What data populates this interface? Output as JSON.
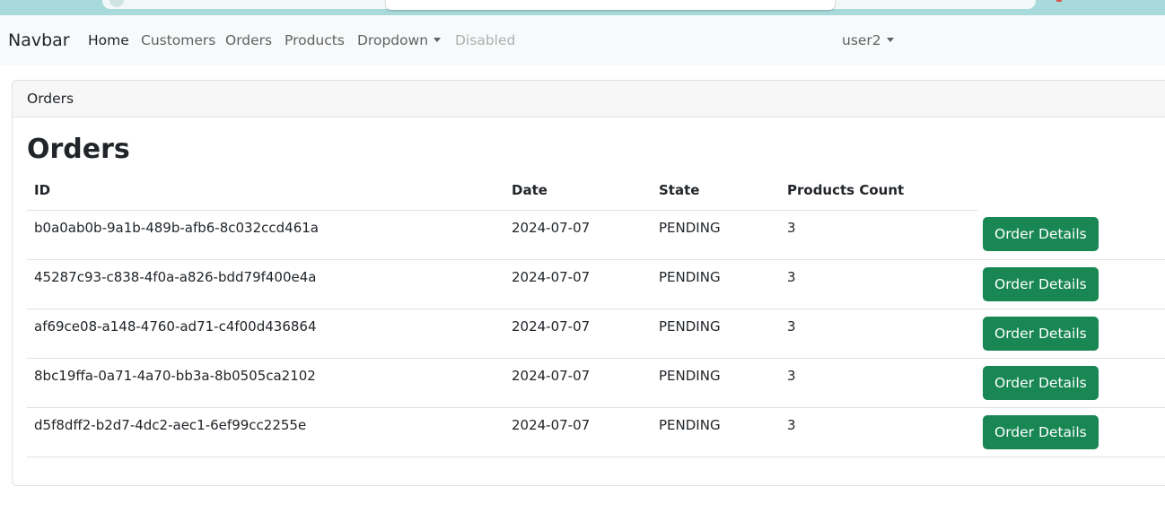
{
  "navbar": {
    "brand": "Navbar",
    "links": [
      {
        "label": "Home",
        "state": "active"
      },
      {
        "label": "Customers",
        "state": "normal"
      },
      {
        "label": "Orders",
        "state": "normal"
      },
      {
        "label": "Products",
        "state": "normal"
      },
      {
        "label": "Dropdown",
        "state": "dropdown"
      },
      {
        "label": "Disabled",
        "state": "disabled"
      }
    ],
    "user": "user2"
  },
  "card": {
    "header": "Orders",
    "title": "Orders"
  },
  "table": {
    "columns": [
      "ID",
      "Date",
      "State",
      "Products Count"
    ],
    "action_label": "Order Details",
    "rows": [
      {
        "id": "b0a0ab0b-9a1b-489b-afb6-8c032ccd461a",
        "date": "2024-07-07",
        "state": "PENDING",
        "count": "3"
      },
      {
        "id": "45287c93-c838-4f0a-a826-bdd79f400e4a",
        "date": "2024-07-07",
        "state": "PENDING",
        "count": "3"
      },
      {
        "id": "af69ce08-a148-4760-ad71-c4f00d436864",
        "date": "2024-07-07",
        "state": "PENDING",
        "count": "3"
      },
      {
        "id": "8bc19ffa-0a71-4a70-bb3a-8b0505ca2102",
        "date": "2024-07-07",
        "state": "PENDING",
        "count": "3"
      },
      {
        "id": "d5f8dff2-b2d7-4dc2-aec1-6ef99cc2255e",
        "date": "2024-07-07",
        "state": "PENDING",
        "count": "3"
      }
    ]
  },
  "colors": {
    "navbar_bg": "#f8f9fa",
    "button_success": "#198754",
    "browser_chrome": "#a9dadb"
  }
}
